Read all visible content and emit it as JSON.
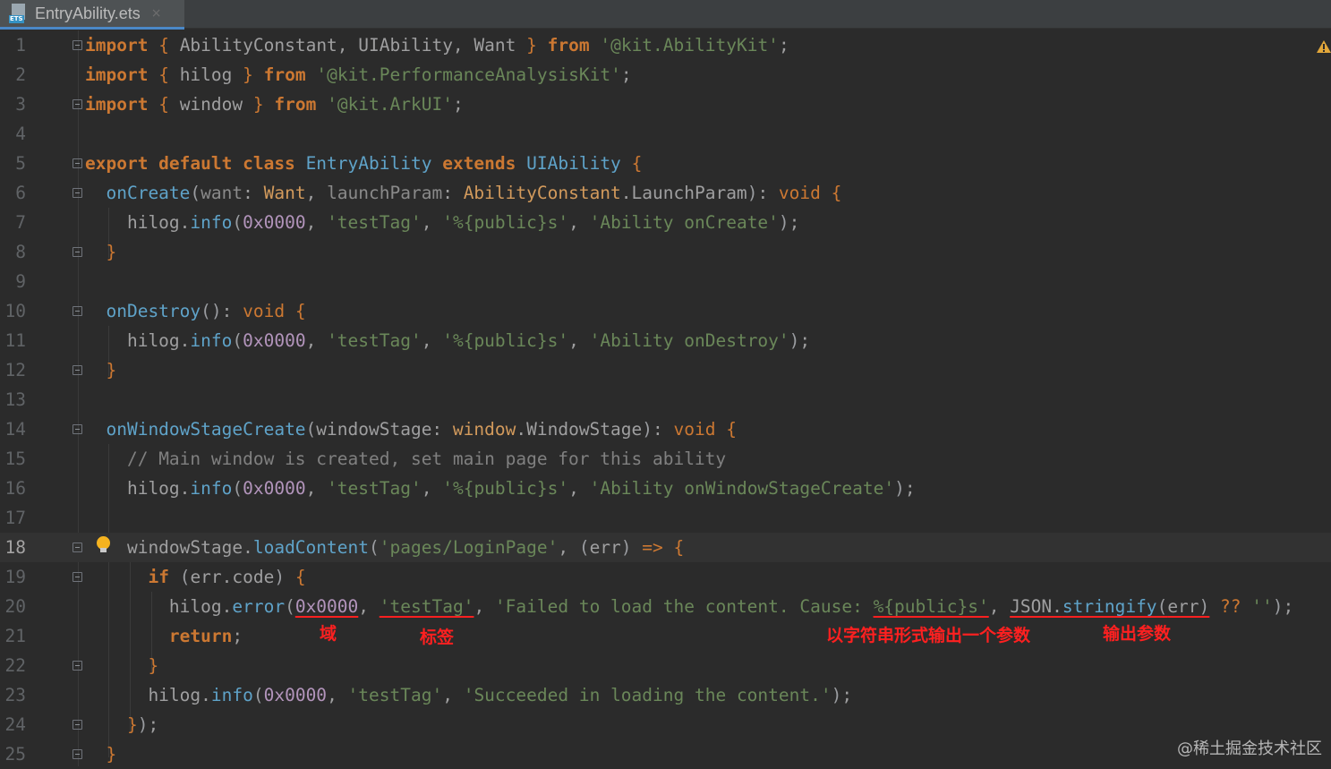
{
  "tab": {
    "title": "EntryAbility.ets",
    "icon": "ets-file-icon",
    "close": "×"
  },
  "lines": [
    {
      "n": "1",
      "fold": true,
      "code": [
        [
          "k",
          "import"
        ],
        [
          "p",
          " "
        ],
        [
          "br",
          "{"
        ],
        [
          "p",
          " AbilityConstant, UIAbility, Want "
        ],
        [
          "br",
          "}"
        ],
        [
          "p",
          " "
        ],
        [
          "k",
          "from"
        ],
        [
          "p",
          " "
        ],
        [
          "s",
          "'@kit.AbilityKit'"
        ],
        [
          "p",
          ";"
        ]
      ]
    },
    {
      "n": "2",
      "fold": false,
      "code": [
        [
          "k",
          "import"
        ],
        [
          "p",
          " "
        ],
        [
          "br",
          "{"
        ],
        [
          "p",
          " hilog "
        ],
        [
          "br",
          "}"
        ],
        [
          "p",
          " "
        ],
        [
          "k",
          "from"
        ],
        [
          "p",
          " "
        ],
        [
          "s",
          "'@kit.PerformanceAnalysisKit'"
        ],
        [
          "p",
          ";"
        ]
      ]
    },
    {
      "n": "3",
      "fold": true,
      "code": [
        [
          "k",
          "import"
        ],
        [
          "p",
          " "
        ],
        [
          "br",
          "{"
        ],
        [
          "p",
          " window "
        ],
        [
          "br",
          "}"
        ],
        [
          "p",
          " "
        ],
        [
          "k",
          "from"
        ],
        [
          "p",
          " "
        ],
        [
          "s",
          "'@kit.ArkUI'"
        ],
        [
          "p",
          ";"
        ]
      ]
    },
    {
      "n": "4",
      "fold": false,
      "code": []
    },
    {
      "n": "5",
      "fold": true,
      "code": [
        [
          "k",
          "export default class"
        ],
        [
          "p",
          " "
        ],
        [
          "f",
          "EntryAbility"
        ],
        [
          "p",
          " "
        ],
        [
          "k",
          "extends"
        ],
        [
          "p",
          " "
        ],
        [
          "f",
          "UIAbility"
        ],
        [
          "p",
          " "
        ],
        [
          "br",
          "{"
        ]
      ]
    },
    {
      "n": "6",
      "fold": true,
      "code": [
        [
          "p",
          "  "
        ],
        [
          "f",
          "onCreate"
        ],
        [
          "n",
          "("
        ],
        [
          "dim",
          "want"
        ],
        [
          "p",
          ": "
        ],
        [
          "t",
          "Want"
        ],
        [
          "p",
          ", "
        ],
        [
          "dim",
          "launchParam"
        ],
        [
          "p",
          ": "
        ],
        [
          "t",
          "AbilityConstant"
        ],
        [
          "p",
          ".LaunchParam"
        ],
        [
          "n",
          ")"
        ],
        [
          "p",
          ": "
        ],
        [
          "kp",
          "void"
        ],
        [
          "p",
          " "
        ],
        [
          "br",
          "{"
        ]
      ]
    },
    {
      "n": "7",
      "fold": false,
      "code": [
        [
          "p",
          "    hilog."
        ],
        [
          "f",
          "info"
        ],
        [
          "n",
          "("
        ],
        [
          "sp",
          "0x0000"
        ],
        [
          "p",
          ", "
        ],
        [
          "s",
          "'testTag'"
        ],
        [
          "p",
          ", "
        ],
        [
          "s",
          "'%{public}s'"
        ],
        [
          "p",
          ", "
        ],
        [
          "s",
          "'Ability onCreate'"
        ],
        [
          "n",
          ")"
        ],
        [
          "p",
          ";"
        ]
      ]
    },
    {
      "n": "8",
      "fold": true,
      "code": [
        [
          "p",
          "  "
        ],
        [
          "br",
          "}"
        ]
      ]
    },
    {
      "n": "9",
      "fold": false,
      "code": []
    },
    {
      "n": "10",
      "fold": true,
      "code": [
        [
          "p",
          "  "
        ],
        [
          "f",
          "onDestroy"
        ],
        [
          "n",
          "()"
        ],
        [
          "p",
          ": "
        ],
        [
          "kp",
          "void"
        ],
        [
          "p",
          " "
        ],
        [
          "br",
          "{"
        ]
      ]
    },
    {
      "n": "11",
      "fold": false,
      "code": [
        [
          "p",
          "    hilog."
        ],
        [
          "f",
          "info"
        ],
        [
          "n",
          "("
        ],
        [
          "sp",
          "0x0000"
        ],
        [
          "p",
          ", "
        ],
        [
          "s",
          "'testTag'"
        ],
        [
          "p",
          ", "
        ],
        [
          "s",
          "'%{public}s'"
        ],
        [
          "p",
          ", "
        ],
        [
          "s",
          "'Ability onDestroy'"
        ],
        [
          "n",
          ")"
        ],
        [
          "p",
          ";"
        ]
      ]
    },
    {
      "n": "12",
      "fold": true,
      "code": [
        [
          "p",
          "  "
        ],
        [
          "br",
          "}"
        ]
      ]
    },
    {
      "n": "13",
      "fold": false,
      "code": []
    },
    {
      "n": "14",
      "fold": true,
      "code": [
        [
          "p",
          "  "
        ],
        [
          "f",
          "onWindowStageCreate"
        ],
        [
          "n",
          "("
        ],
        [
          "p",
          "windowStage: "
        ],
        [
          "t",
          "window"
        ],
        [
          "p",
          ".WindowStage"
        ],
        [
          "n",
          ")"
        ],
        [
          "p",
          ": "
        ],
        [
          "kp",
          "void"
        ],
        [
          "p",
          " "
        ],
        [
          "br",
          "{"
        ]
      ]
    },
    {
      "n": "15",
      "fold": false,
      "code": [
        [
          "p",
          "    "
        ],
        [
          "c",
          "// Main window is created, set main page for this ability"
        ]
      ]
    },
    {
      "n": "16",
      "fold": false,
      "code": [
        [
          "p",
          "    hilog."
        ],
        [
          "f",
          "info"
        ],
        [
          "n",
          "("
        ],
        [
          "sp",
          "0x0000"
        ],
        [
          "p",
          ", "
        ],
        [
          "s",
          "'testTag'"
        ],
        [
          "p",
          ", "
        ],
        [
          "s",
          "'%{public}s'"
        ],
        [
          "p",
          ", "
        ],
        [
          "s",
          "'Ability onWindowStageCreate'"
        ],
        [
          "n",
          ")"
        ],
        [
          "p",
          ";"
        ]
      ]
    },
    {
      "n": "17",
      "fold": false,
      "code": []
    },
    {
      "n": "18",
      "fold": true,
      "current": true,
      "bulb": true,
      "code": [
        [
          "p",
          "    windowStage."
        ],
        [
          "f",
          "loadContent"
        ],
        [
          "n",
          "("
        ],
        [
          "s",
          "'pages/LoginPage'"
        ],
        [
          "p",
          ", "
        ],
        [
          "n",
          "("
        ],
        [
          "p",
          "err"
        ],
        [
          "n",
          ")"
        ],
        [
          "p",
          " "
        ],
        [
          "kp",
          "=>"
        ],
        [
          "p",
          " "
        ],
        [
          "br",
          "{"
        ]
      ]
    },
    {
      "n": "19",
      "fold": true,
      "code": [
        [
          "p",
          "      "
        ],
        [
          "k",
          "if"
        ],
        [
          "p",
          " "
        ],
        [
          "n",
          "("
        ],
        [
          "p",
          "err.code"
        ],
        [
          "n",
          ")"
        ],
        [
          "p",
          " "
        ],
        [
          "br",
          "{"
        ]
      ]
    },
    {
      "n": "20",
      "fold": false,
      "code": [
        [
          "p",
          "        hilog."
        ],
        [
          "f",
          "error"
        ],
        [
          "n",
          "("
        ],
        [
          "sp ul",
          "0x0000"
        ],
        [
          "p",
          ", "
        ],
        [
          "s ul",
          "'testTag'"
        ],
        [
          "p",
          ", "
        ],
        [
          "s",
          "'Failed to load the content. Cause: "
        ],
        [
          "s ul",
          "%{public}s'"
        ],
        [
          "p",
          ", "
        ],
        [
          "p ul",
          "JSON."
        ],
        [
          "f ul",
          "stringify"
        ],
        [
          "n ul",
          "("
        ],
        [
          "p ul",
          "err"
        ],
        [
          "n ul",
          ")"
        ],
        [
          "p",
          " "
        ],
        [
          "kp",
          "??"
        ],
        [
          "p",
          " "
        ],
        [
          "s",
          "''"
        ],
        [
          "n",
          ")"
        ],
        [
          "p",
          ";"
        ]
      ]
    },
    {
      "n": "21",
      "fold": false,
      "code": [
        [
          "p",
          "        "
        ],
        [
          "k",
          "return"
        ],
        [
          "p",
          ";"
        ]
      ]
    },
    {
      "n": "22",
      "fold": true,
      "code": [
        [
          "p",
          "      "
        ],
        [
          "br",
          "}"
        ]
      ]
    },
    {
      "n": "23",
      "fold": false,
      "code": [
        [
          "p",
          "      hilog."
        ],
        [
          "f",
          "info"
        ],
        [
          "n",
          "("
        ],
        [
          "sp",
          "0x0000"
        ],
        [
          "p",
          ", "
        ],
        [
          "s",
          "'testTag'"
        ],
        [
          "p",
          ", "
        ],
        [
          "s",
          "'Succeeded in loading the content.'"
        ],
        [
          "n",
          ")"
        ],
        [
          "p",
          ";"
        ]
      ]
    },
    {
      "n": "24",
      "fold": true,
      "code": [
        [
          "p",
          "    "
        ],
        [
          "br",
          "}"
        ],
        [
          "n",
          ")"
        ],
        [
          "p",
          ";"
        ]
      ]
    },
    {
      "n": "25",
      "fold": true,
      "code": [
        [
          "p",
          "  "
        ],
        [
          "br",
          "}"
        ]
      ]
    }
  ],
  "annotations": {
    "domain": "域",
    "tag": "标签",
    "format": "以字符串形式输出一个参数",
    "params": "输出参数"
  },
  "watermark": "@稀土掘金技术社区",
  "status": {
    "warning_icon": "warning-triangle-icon"
  },
  "colors": {
    "background": "#2b2b2b",
    "keyword": "#cc7832",
    "string": "#6a8759",
    "annotation": "#ff2020"
  }
}
